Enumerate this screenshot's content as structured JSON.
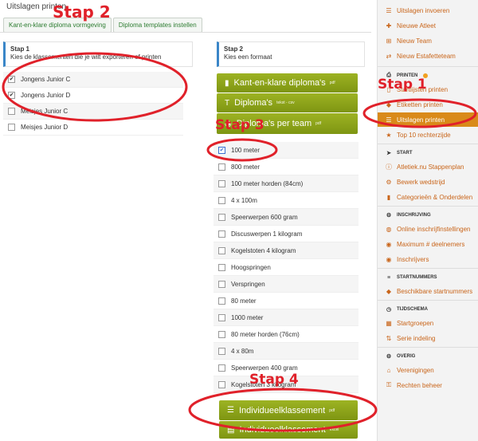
{
  "page": {
    "title": "Uitslagen printen"
  },
  "tabs": [
    "Kant-en-klare diploma vormgeving",
    "Diploma templates instellen"
  ],
  "step1": {
    "heading": "Stap 1",
    "text": "Kies de klassementen die je wilt exporteren of printen"
  },
  "classes": [
    {
      "label": "Jongens Junior C",
      "checked": true
    },
    {
      "label": "Jongens Junior D",
      "checked": true
    },
    {
      "label": "Meisjes Junior C",
      "checked": false
    },
    {
      "label": "Meisjes Junior D",
      "checked": false
    }
  ],
  "step2": {
    "heading": "Stap 2",
    "text": "Kies een formaat"
  },
  "format_buttons": [
    {
      "label": "Kant-en-klare diploma's",
      "tag": "pdf",
      "icon": "book-icon"
    },
    {
      "label": "Diploma's",
      "tag": "tekst - csv",
      "icon": "text-height-icon"
    },
    {
      "label": "Diploma's per team",
      "tag": "pdf",
      "icon": "users-icon"
    }
  ],
  "events": [
    {
      "label": "100 meter",
      "checked": true
    },
    {
      "label": "800 meter",
      "checked": false
    },
    {
      "label": "100 meter horden (84cm)",
      "checked": false
    },
    {
      "label": "4 x 100m",
      "checked": false
    },
    {
      "label": "Speerwerpen 600 gram",
      "checked": false
    },
    {
      "label": "Discuswerpen 1 kilogram",
      "checked": false
    },
    {
      "label": "Kogelstoten 4 kilogram",
      "checked": false
    },
    {
      "label": "Hoogspringen",
      "checked": false
    },
    {
      "label": "Verspringen",
      "checked": false
    },
    {
      "label": "80 meter",
      "checked": false
    },
    {
      "label": "1000 meter",
      "checked": false
    },
    {
      "label": "80 meter horden (76cm)",
      "checked": false
    },
    {
      "label": "4 x 80m",
      "checked": false
    },
    {
      "label": "Speerwerpen 400 gram",
      "checked": false
    },
    {
      "label": "Kogelstoten 3 kilogram",
      "checked": false
    }
  ],
  "export_buttons": [
    {
      "label": "Individueelklassement",
      "tag": "pdf",
      "icon": "list-icon"
    },
    {
      "label": "Individueelklassement",
      "tag": "excel",
      "icon": "file-excel-icon"
    }
  ],
  "sidebar": {
    "top_items": [
      {
        "label": "Uitslagen invoeren",
        "icon": "list-icon"
      },
      {
        "label": "Nieuwe Atleet",
        "icon": "user-plus-icon"
      },
      {
        "label": "Nieuw Team",
        "icon": "sitemap-icon"
      },
      {
        "label": "Nieuw Estafetteteam",
        "icon": "shuffle-icon"
      }
    ],
    "printen": {
      "heading": "PRINTEN",
      "items": [
        {
          "label": "Startlijsten printen",
          "icon": "file-icon"
        },
        {
          "label": "Etiketten printen",
          "icon": "tag-icon"
        },
        {
          "label": "Uitslagen printen",
          "icon": "list-icon",
          "active": true
        },
        {
          "label": "Top 10 rechterzijde",
          "icon": "trophy-icon"
        }
      ]
    },
    "start": {
      "heading": "START",
      "items": [
        {
          "label": "Atletiek.nu Stappenplan",
          "icon": "info-icon"
        },
        {
          "label": "Bewerk wedstrijd",
          "icon": "gear-icon"
        },
        {
          "label": "Categorieën & Onderdelen",
          "icon": "book-icon"
        }
      ]
    },
    "inschrijving": {
      "heading": "INSCHRIJVING",
      "items": [
        {
          "label": "Online inschrijfinstellingen",
          "icon": "globe-icon"
        },
        {
          "label": "Maximum # deelnemers",
          "icon": "users-icon"
        },
        {
          "label": "Inschrijvers",
          "icon": "users-icon"
        }
      ]
    },
    "startnummers": {
      "heading": "STARTNUMMERS",
      "items": [
        {
          "label": "Beschikbare startnummers",
          "icon": "tag-icon"
        }
      ]
    },
    "tijdschema": {
      "heading": "TIJDSCHEMA",
      "items": [
        {
          "label": "Startgroepen",
          "icon": "calendar-icon"
        },
        {
          "label": "Serie indeling",
          "icon": "sort-icon"
        }
      ]
    },
    "overig": {
      "heading": "OVERIG",
      "items": [
        {
          "label": "Verenigingen",
          "icon": "home-icon"
        },
        {
          "label": "Rechten beheer",
          "icon": "key-icon"
        }
      ]
    }
  },
  "annotations": {
    "stap1": "Stap 1",
    "stap2": "Stap 2",
    "stap3": "Stap 3",
    "stap4": "Stap 4",
    "color": "#e0212a"
  },
  "colors": {
    "accent": "#d98a1a",
    "button_green": "#8ca31b",
    "link_orange": "#c9651a",
    "tab_green": "#2e7d32"
  }
}
